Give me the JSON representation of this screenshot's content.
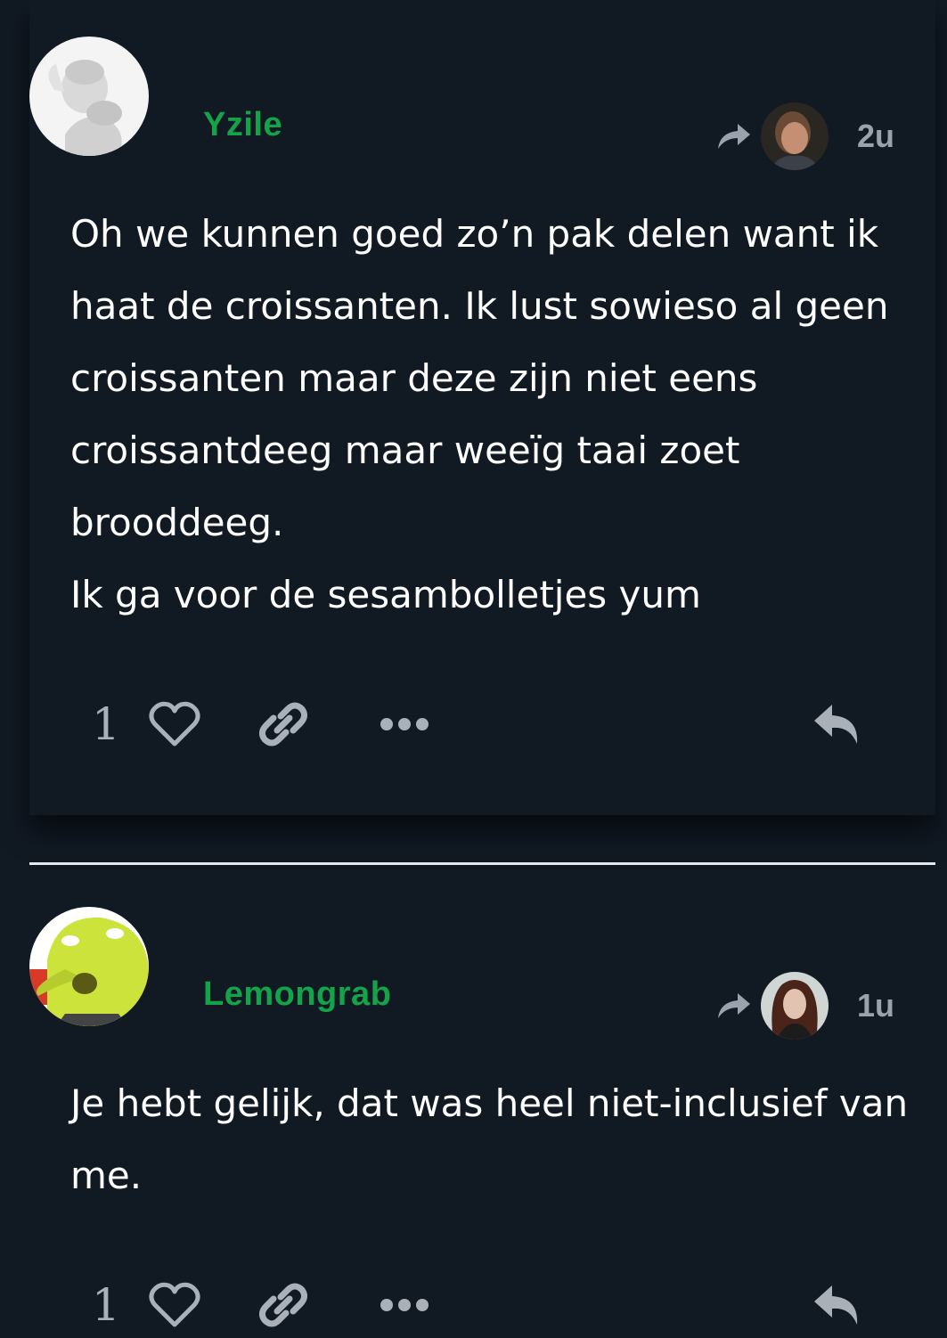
{
  "posts": [
    {
      "author": "Yzile",
      "time": "2u",
      "paragraphs": [
        "Oh we kunnen goed zo’n pak delen want ik haat de croissanten. Ik lust sowieso al geen croissanten maar deze zijn niet eens croissantdeeg maar weeïg taai zoet brooddeeg.",
        "Ik ga voor de sesambolletjes yum"
      ],
      "likes": "1"
    },
    {
      "author": "Lemongrab",
      "time": "1u",
      "paragraphs": [
        "Je hebt gelijk, dat was heel niet-inclusief van me."
      ],
      "likes": "1"
    }
  ],
  "icons": [
    "share-icon",
    "heart-icon",
    "link-icon",
    "more-icon",
    "reply-icon"
  ],
  "colors": {
    "background": "#111923",
    "username": "#15a34a",
    "muted": "#9aa3ad",
    "text": "#ffffff"
  }
}
